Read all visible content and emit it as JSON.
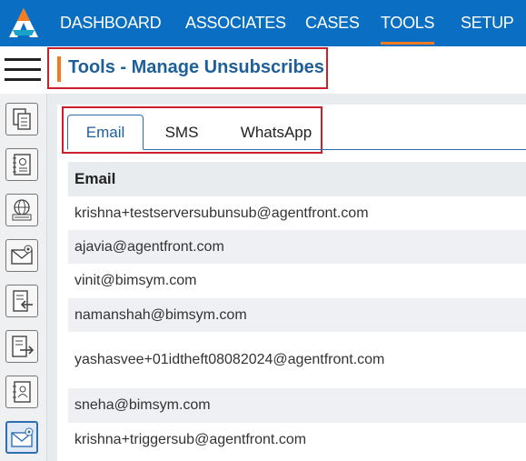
{
  "nav": {
    "items": [
      {
        "label": "DASHBOARD",
        "active": false
      },
      {
        "label": "ASSOCIATES",
        "active": false
      },
      {
        "label": "CASES",
        "active": false
      },
      {
        "label": "TOOLS",
        "active": true
      },
      {
        "label": "SETUP",
        "active": false
      }
    ]
  },
  "sidebar": {
    "icons": [
      "copy-docs-icon",
      "ledger-icon",
      "web-doc-icon",
      "mail-settings-icon",
      "doc-import-icon",
      "doc-export-icon",
      "contact-book-icon",
      "mail-unsubscribe-icon"
    ],
    "active_index": 7
  },
  "page": {
    "title": "Tools - Manage Unsubscribes"
  },
  "tabs": [
    {
      "label": "Email",
      "active": true
    },
    {
      "label": "SMS",
      "active": false
    },
    {
      "label": "WhatsApp",
      "active": false
    }
  ],
  "table": {
    "header": "Email",
    "rows": [
      "krishna+testserversubunsub@agentfront.com",
      "ajavia@agentfront.com",
      "vinit@bimsym.com",
      "namanshah@bimsym.com",
      "yashasvee+01idtheft08082024@agentfront.com",
      "sneha@bimsym.com",
      "krishna+triggersub@agentfront.com"
    ]
  },
  "colors": {
    "brand_blue": "#0a6fc2",
    "accent_orange": "#f47c20",
    "highlight_red": "#cc1f2d",
    "title_blue": "#1f5f99"
  }
}
